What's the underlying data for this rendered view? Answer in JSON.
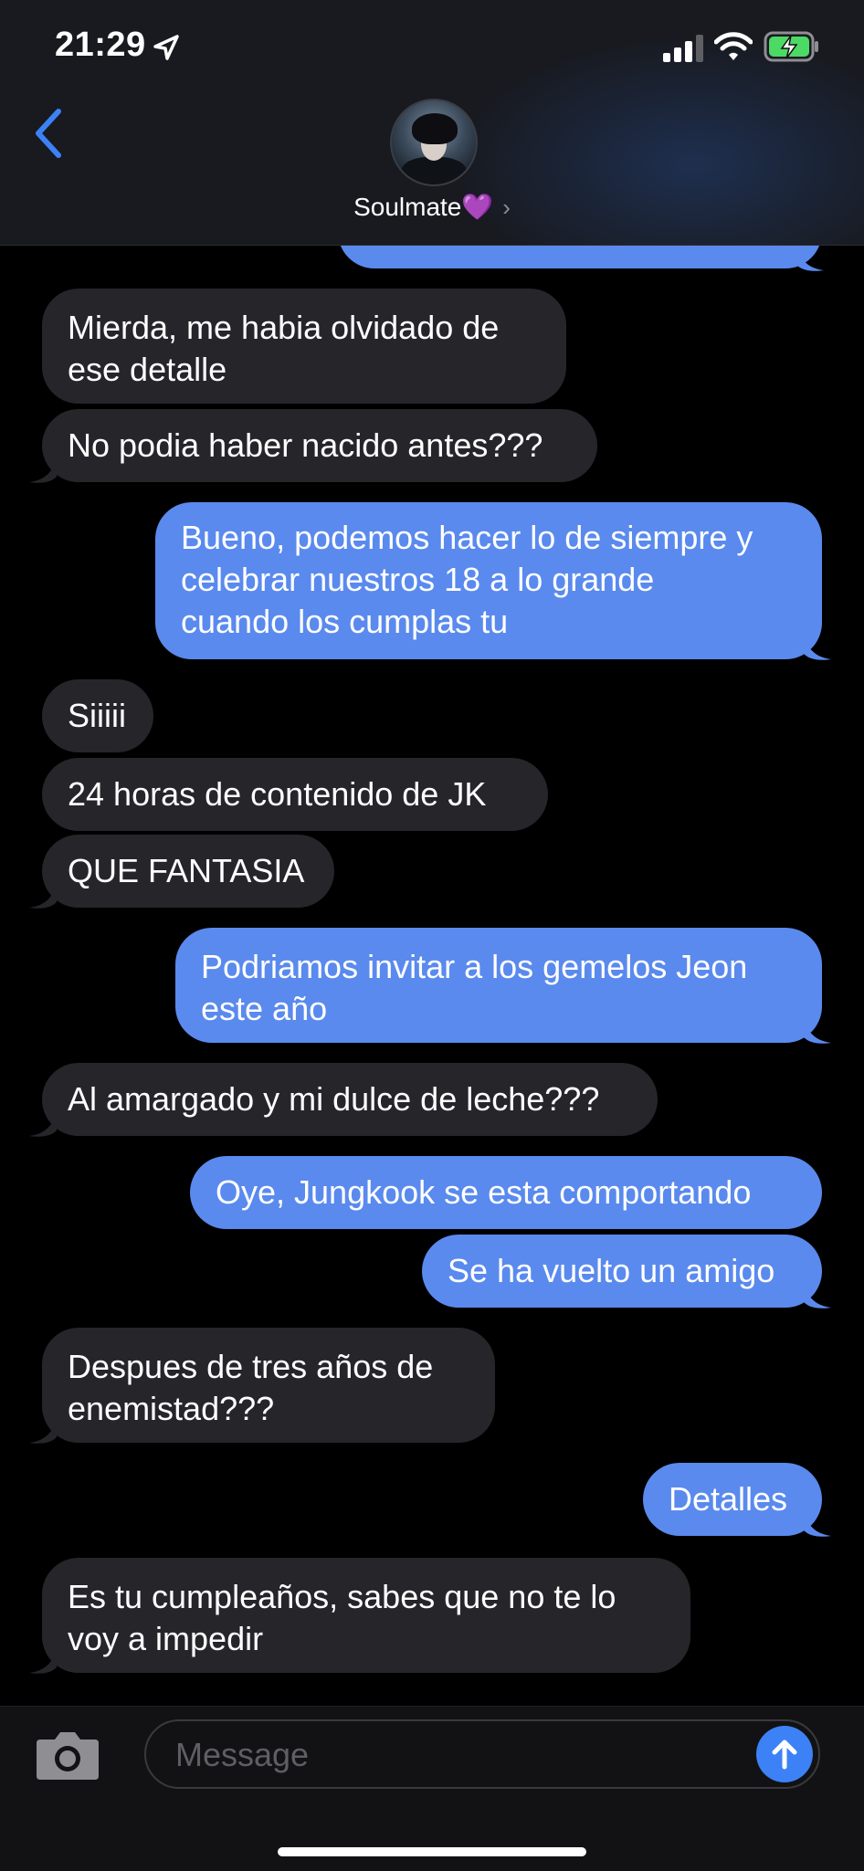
{
  "status_bar": {
    "time": "21:29"
  },
  "header": {
    "contact_name": "Soulmate💜",
    "chevron": "›"
  },
  "messages": [
    {
      "from": "recv",
      "text": "Mierda, me habia olvidado de\nese detalle"
    },
    {
      "from": "recv",
      "text": "No podia haber nacido antes???"
    },
    {
      "from": "sent",
      "text": "Bueno, podemos hacer lo de siempre y\ncelebrar nuestros 18 a lo grande\ncuando los cumplas tu"
    },
    {
      "from": "recv",
      "text": "Siiiii"
    },
    {
      "from": "recv",
      "text": "24 horas de contenido de JK"
    },
    {
      "from": "recv",
      "text": "QUE FANTASIA"
    },
    {
      "from": "sent",
      "text": "Podriamos invitar a los gemelos Jeon\neste año"
    },
    {
      "from": "recv",
      "text": "Al amargado y mi dulce de leche???"
    },
    {
      "from": "sent",
      "text": "Oye, Jungkook se esta comportando"
    },
    {
      "from": "sent",
      "text": "Se ha vuelto un amigo"
    },
    {
      "from": "recv",
      "text": "Despues de tres años de\nenemistad???"
    },
    {
      "from": "sent",
      "text": "Detalles"
    },
    {
      "from": "recv",
      "text": "Es tu cumpleaños, sabes que no te lo\nvoy a impedir"
    }
  ],
  "composer": {
    "placeholder": "Message"
  },
  "colors": {
    "sent_bubble": "#5a8aee",
    "received_bubble": "#26252a",
    "accent": "#3c82f6"
  }
}
